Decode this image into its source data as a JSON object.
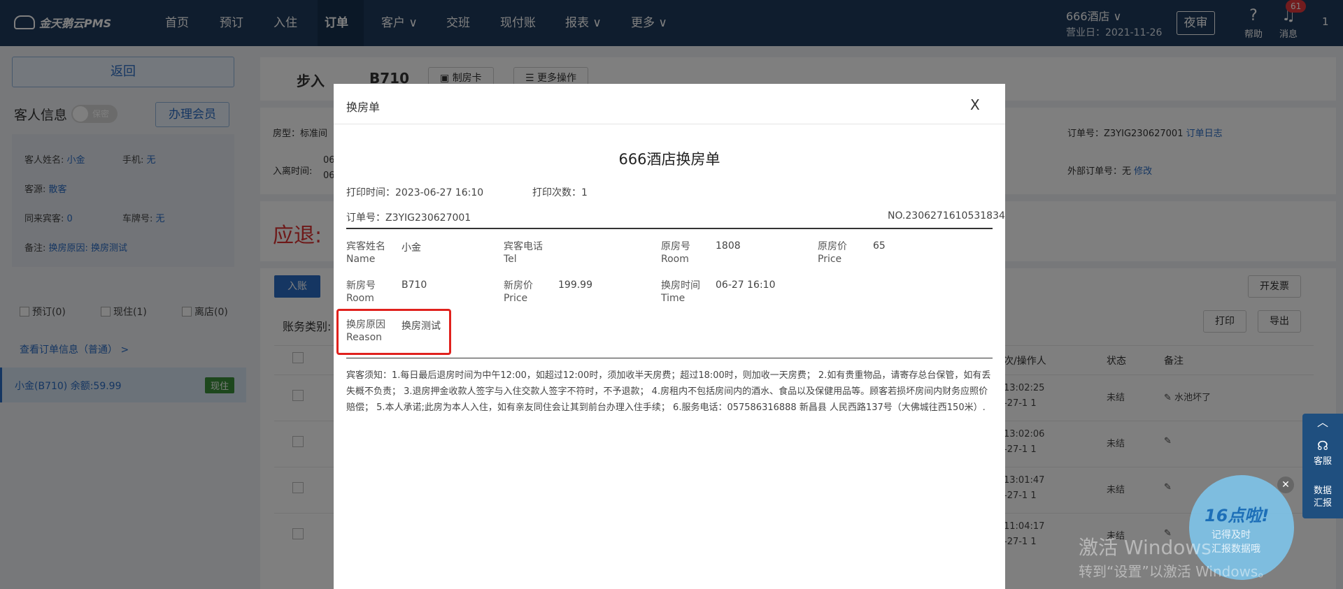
{
  "app": {
    "logo": "金天鹅云PMS"
  },
  "nav": {
    "items": [
      "首页",
      "预订",
      "入住",
      "订单",
      "客户 ∨",
      "交班",
      "现付账",
      "报表 ∨",
      "更多 ∨"
    ],
    "hotel": "666酒店 ∨",
    "business_date": "营业日：2021-11-26",
    "night_audit": "夜审",
    "help": "帮助",
    "messages": "消息",
    "message_count": "61",
    "more": "1"
  },
  "left": {
    "back": "返回",
    "guest_title": "客人信息",
    "privacy_toggle": "保密",
    "member_button": "办理会员",
    "guest_name_label": "客人姓名:",
    "guest_name": "小金",
    "phone_label": "手机:",
    "phone": "无",
    "source_label": "客源:",
    "source": "散客",
    "companions_label": "同来宾客:",
    "companions": "0",
    "plate_label": "车牌号:",
    "plate": "无",
    "remark_label": "备注:",
    "remark": "换房原因: 换房测试",
    "filter_reserve": "预订(0)",
    "filter_current": "现住(1)",
    "filter_left": "离店(0)",
    "view_order": "查看订单信息（普通） >",
    "guest_row": "小金(B710)  余额:59.99",
    "guest_row_tag": "现住"
  },
  "main": {
    "tab_walkin": "步入",
    "room_no": "B710",
    "make_card": "制房卡",
    "more_ops": "更多操作",
    "room_type": "房型：标准间",
    "checkin_label": "入离时间:",
    "checkin_1": "06",
    "checkin_2": "06",
    "order_no_label": "订单号：Z3YIG230627001",
    "order_log": "订单日志",
    "ext_order_label": "外部订单号：",
    "ext_order_value": "无",
    "ext_order_edit": "修改",
    "refund_label": "应退:",
    "post_btn": "入账",
    "invoice_btn": "开发票",
    "account_type": "账务类别:",
    "print_btn": "打印",
    "export_btn": "导出",
    "col_shift": "次/操作人",
    "col_status": "状态",
    "col_remark": "备注",
    "rows": [
      {
        "time": "13:02:25",
        "date": "-27-1 1",
        "status": "未结",
        "remark": "✎ 水池坏了"
      },
      {
        "time": "13:02:06",
        "date": "-27-1 1",
        "status": "未结",
        "remark": "✎"
      },
      {
        "time": "13:01:47",
        "date": "-27-1 1",
        "status": "未结",
        "remark": "✎"
      },
      {
        "time": "11:04:17",
        "date": "-27-1 1",
        "status": "未结",
        "remark": "✎"
      }
    ]
  },
  "modal": {
    "title": "换房单",
    "close": "X",
    "doc_title": "666酒店换房单",
    "print_time": "打印时间：2023-06-27 16:10",
    "print_count": "打印次数：1",
    "order_no": "订单号：Z3YIG230627001",
    "doc_no": "NO.2306271610531834",
    "guest_name_cn": "宾客姓名",
    "guest_name_en": "Name",
    "guest_name_val": "小金",
    "tel_cn": "宾客电话",
    "tel_en": "Tel",
    "orig_room_cn": "原房号",
    "orig_room_en": "Room",
    "orig_room_val": "1808",
    "orig_price_cn": "原房价",
    "orig_price_en": "Price",
    "orig_price_val": "65",
    "new_room_cn": "新房号",
    "new_room_en": "Room",
    "new_room_val": "B710",
    "new_price_cn": "新房价",
    "new_price_en": "Price",
    "new_price_val": "199.99",
    "change_time_cn": "换房时间",
    "change_time_en": "Time",
    "change_time_val": "06-27 16:10",
    "reason_cn": "换房原因",
    "reason_en": "Reason",
    "reason_val": "换房测试",
    "notice": "宾客须知：1.每日最后退房时间为中午12:00，如超过12:00时，须加收半天房费；超过18:00时，则加收一天房费； 2.如有贵重物品，请寄存总台保管，如有丢失概不负责； 3.退房押金收款人签字与入住交款人签字不符时，不予退款； 4.房租内不包括房间内的酒水、食品以及保健用品等。顾客若损坏房间内财务应照价赔偿； 5.本人承诺;此房为本人入住，如有亲友同住会让其到前台办理入住手续； 6.服务电话：057586316888 新昌县 人民西路137号（大佛城往西150米）."
  },
  "float": {
    "service": "客服",
    "report_1": "数据",
    "report_2": "汇报",
    "promo_title": "16点啦!",
    "promo_sub_1": "记得及时",
    "promo_sub_2": "汇报数据哦",
    "watermark_1": "激活 Windows",
    "watermark_2": "转到“设置”以激活 Windows。"
  }
}
